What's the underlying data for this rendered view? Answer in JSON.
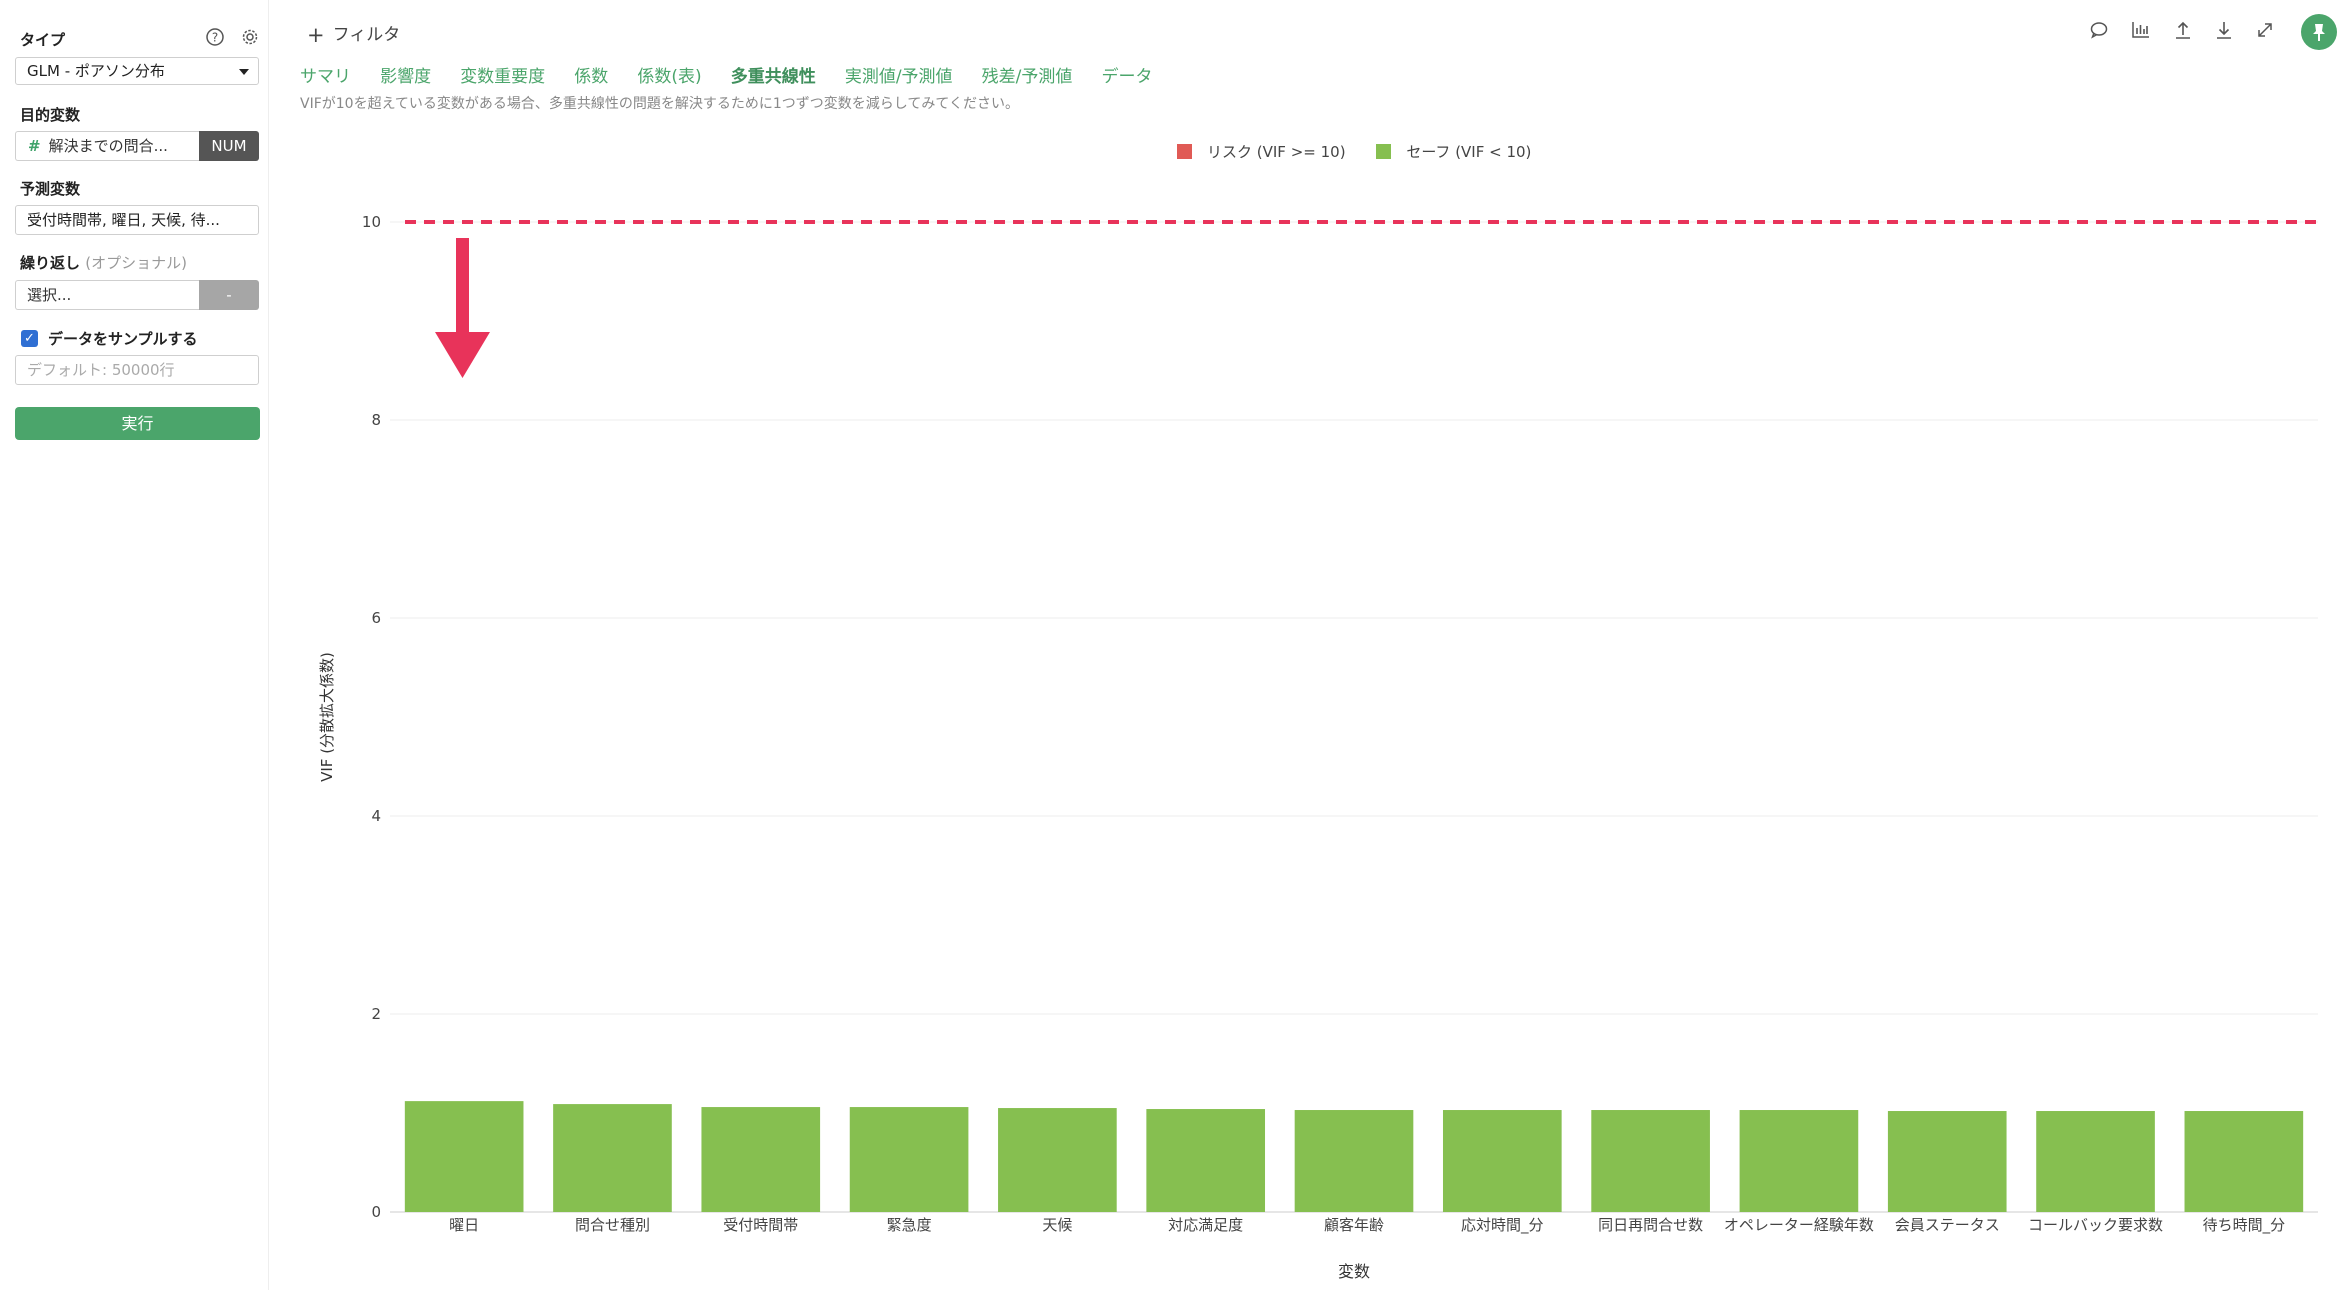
{
  "sidebar": {
    "type_label": "タイプ",
    "type_value": "GLM - ポアソン分布",
    "target_label": "目的変数",
    "target_value": "解決までの問合...",
    "target_badge": "NUM",
    "predictors_label": "予測変数",
    "predictors_value": "受付時間帯, 曜日, 天候, 待...",
    "repeat_label": "繰り返し",
    "repeat_optional": "(オプショナル)",
    "repeat_value": "選択...",
    "repeat_btn": "-",
    "sample_label": "データをサンプルする",
    "sample_placeholder": "デフォルト: 50000行",
    "run_label": "実行"
  },
  "header": {
    "filter_label": "フィルタ"
  },
  "tabs": [
    {
      "label": "サマリ"
    },
    {
      "label": "影響度"
    },
    {
      "label": "変数重要度"
    },
    {
      "label": "係数"
    },
    {
      "label": "係数(表)"
    },
    {
      "label": "多重共線性",
      "active": true
    },
    {
      "label": "実測値/予測値"
    },
    {
      "label": "残差/予測値"
    },
    {
      "label": "データ"
    }
  ],
  "note": "VIFが10を超えている変数がある場合、多重共線性の問題を解決するために1つずつ変数を減らしてみてください。",
  "colors": {
    "accent": "#4ba56b",
    "risk": "#e05a55",
    "safe": "#86bf50",
    "threshold": "#e8335a"
  },
  "chart_data": {
    "type": "bar",
    "legend": [
      {
        "name": "リスク (VIF >= 10)",
        "color": "#e05a55"
      },
      {
        "name": "セーフ (VIF < 10)",
        "color": "#86bf50"
      }
    ],
    "legend_position": "top-center",
    "xlabel": "変数",
    "ylabel": "VIF (分散拡大係数)",
    "ylim": [
      0,
      10
    ],
    "yticks": [
      0,
      2,
      4,
      6,
      8,
      10
    ],
    "grid": true,
    "threshold": 10,
    "categories": [
      "曜日",
      "問合せ種別",
      "受付時間帯",
      "緊急度",
      "天候",
      "対応満足度",
      "顧客年齢",
      "応対時間_分",
      "同日再問合せ数",
      "オペレーター経験年数",
      "会員ステータス",
      "コールバック要求数",
      "待ち時間_分"
    ],
    "values": [
      1.12,
      1.09,
      1.06,
      1.06,
      1.05,
      1.04,
      1.03,
      1.03,
      1.03,
      1.03,
      1.02,
      1.02,
      1.02
    ]
  }
}
